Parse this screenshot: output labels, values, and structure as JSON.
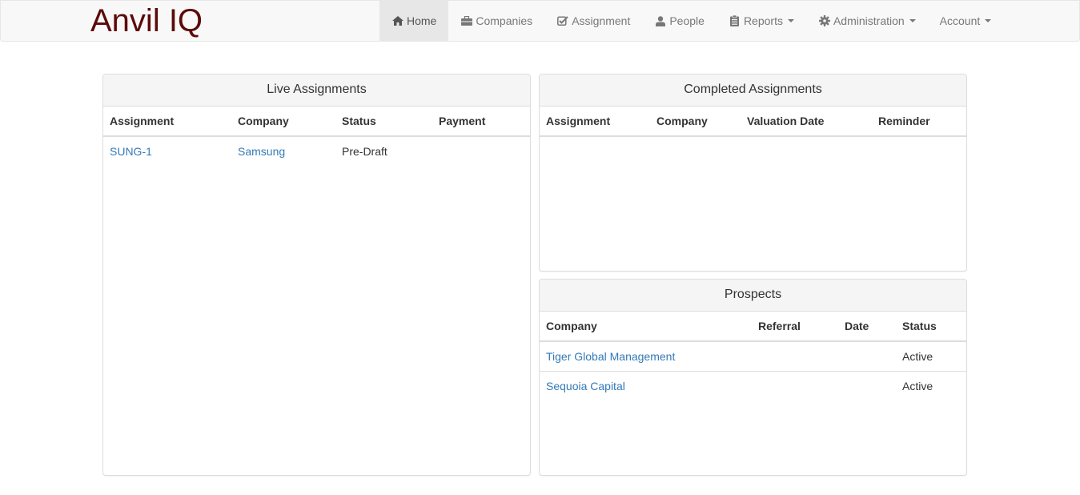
{
  "brand": "Anvil IQ",
  "nav": {
    "home": "Home",
    "companies": "Companies",
    "assignment": "Assignment",
    "people": "People",
    "reports": "Reports",
    "administration": "Administration",
    "account": "Account"
  },
  "live": {
    "title": "Live Assignments",
    "headers": [
      "Assignment",
      "Company",
      "Status",
      "Payment"
    ],
    "rows": [
      {
        "assignment": "SUNG-1",
        "company": "Samsung",
        "status": "Pre-Draft",
        "payment": ""
      }
    ]
  },
  "completed": {
    "title": "Completed Assignments",
    "headers": [
      "Assignment",
      "Company",
      "Valuation Date",
      "Reminder"
    ],
    "rows": []
  },
  "prospects": {
    "title": "Prospects",
    "headers": [
      "Company",
      "Referral",
      "Date",
      "Status"
    ],
    "rows": [
      {
        "company": "Tiger Global Management",
        "referral": "",
        "date": "",
        "status": "Active"
      },
      {
        "company": "Sequoia Capital",
        "referral": "",
        "date": "",
        "status": "Active"
      }
    ]
  },
  "colors": {
    "brand": "#5c0a0a",
    "link": "#337ab7",
    "navbar_bg": "#f8f8f8",
    "active_tab_bg": "#e7e7e7"
  },
  "icons": {
    "home": "home-icon",
    "companies": "briefcase-icon",
    "assignment": "check-square-icon",
    "people": "user-icon",
    "reports": "clipboard-icon",
    "administration": "gear-icon"
  }
}
